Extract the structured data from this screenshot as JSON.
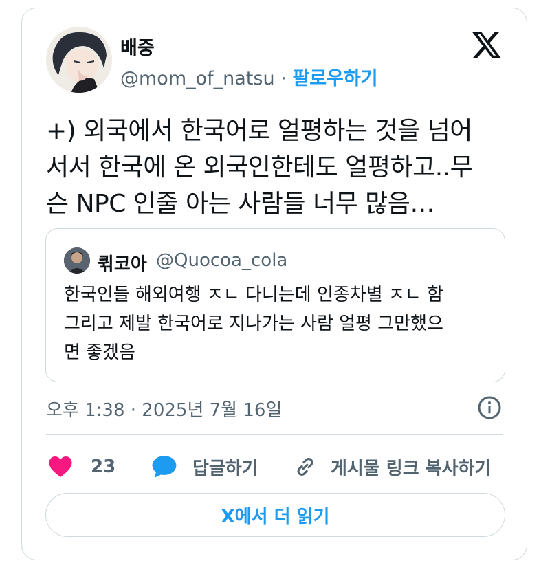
{
  "author": {
    "display_name": "배중",
    "handle": "@mom_of_natsu",
    "separator": "·",
    "follow_label": "팔로우하기"
  },
  "logo_icon": "x-logo-icon",
  "tweet": {
    "lines": [
      "+) 외국에서 한국어로 얼평하는 것을 넘어",
      "서서 한국에 온 외국인한테도 얼평하고..무",
      "슨 NPC 인줄 아는 사람들 너무 많음…"
    ]
  },
  "quoted_tweet": {
    "display_name": "퀶코아",
    "handle": "@Quocoa_cola",
    "lines": [
      "한국인들 해외여행 ㅈㄴ 다니는데 인종차별 ㅈㄴ 함",
      "그리고 제발 한국어로 지나가는 사람 얼평 그만했으",
      "면 좋겠음"
    ]
  },
  "timestamp": "오후 1:38 · 2025년 7월 16일",
  "actions": {
    "like_count": "23",
    "reply_label": "답글하기",
    "copy_link_label": "게시물 링크 복사하기"
  },
  "read_more_label": "X에서 더 읽기",
  "colors": {
    "accent": "#1d9bf0",
    "like": "#f91880",
    "text": "#0f1419",
    "secondary": "#536471",
    "border": "#cfd9de"
  }
}
